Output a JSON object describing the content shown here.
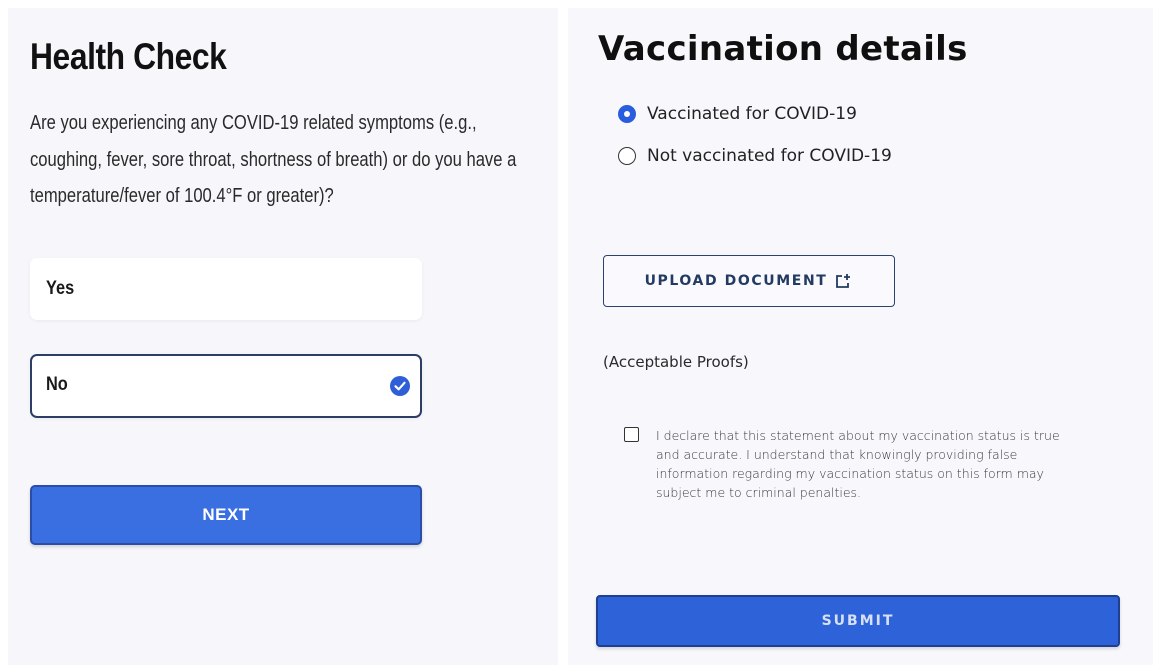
{
  "health_check": {
    "title": "Health Check",
    "question_lines": [
      "Are you experiencing any COVID-19 related symptoms (e.g.,",
      "coughing, fever, sore throat, shortness of breath) or do you have a",
      "temperature/fever of 100.4°F or greater)?"
    ],
    "options": [
      {
        "label": "Yes",
        "selected": false
      },
      {
        "label": "No",
        "selected": true
      }
    ],
    "next_label": "NEXT"
  },
  "vaccination": {
    "title": "Vaccination details",
    "radios": [
      {
        "label": "Vaccinated for COVID-19",
        "checked": true
      },
      {
        "label": "Not vaccinated for COVID-19",
        "checked": false
      }
    ],
    "upload_label": "UPLOAD DOCUMENT",
    "proofs_label": "(Acceptable Proofs)",
    "declaration_lines": [
      "I declare that this statement about my vaccination status is true",
      "and accurate. I understand that knowingly providing false",
      "information regarding my vaccination status on this form may",
      "subject me to criminal penalties."
    ],
    "declaration_checked": false,
    "submit_label": "SUBMIT"
  },
  "colors": {
    "primary_button": "#3a6fe2",
    "selected_border": "#2c3e63",
    "check_icon": "#2f5fd6",
    "radio_checked": "#2a5ce0"
  },
  "icons": {
    "selected_option": "check-circle-icon",
    "upload": "upload-document-icon"
  }
}
